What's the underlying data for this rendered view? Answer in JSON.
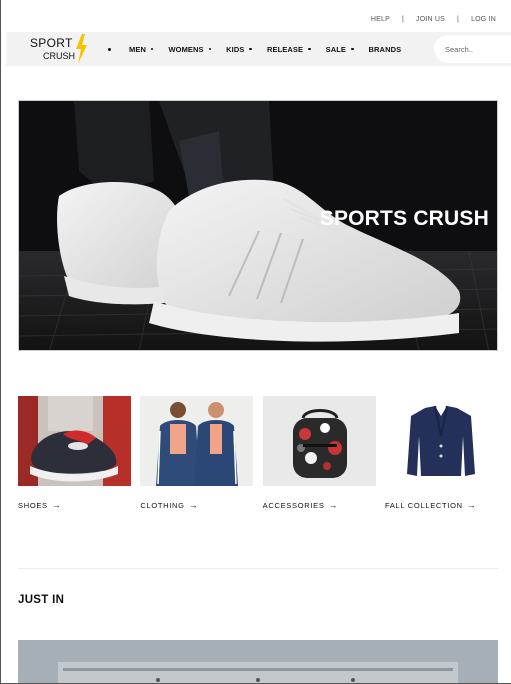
{
  "utility_links": [
    "HELP",
    "JOIN US",
    "LOG IN"
  ],
  "utility_separator": "|",
  "logo": {
    "line1": "SPORT",
    "line2": "CRUSH"
  },
  "nav": {
    "items": [
      {
        "label": "MEN"
      },
      {
        "label": "WOMENS"
      },
      {
        "label": "KIDS"
      },
      {
        "label": "RELEASE"
      },
      {
        "label": "SALE"
      },
      {
        "label": "BRANDS"
      }
    ]
  },
  "search": {
    "placeholder": "Search.."
  },
  "hero": {
    "title": "SPORTS CRUSH"
  },
  "categories": [
    {
      "label": "SHOES",
      "arrow": "→"
    },
    {
      "label": "CLOTHING",
      "arrow": "→"
    },
    {
      "label": "ACCESSORIES",
      "arrow": "→"
    },
    {
      "label": "FALL COLLECTION",
      "arrow": "→"
    }
  ],
  "section": {
    "title": "JUST IN"
  },
  "colors": {
    "accent_bolt": "#f5c400",
    "nav_bg": "#f2f2f2",
    "hero_bg": "#1b1b1d"
  }
}
